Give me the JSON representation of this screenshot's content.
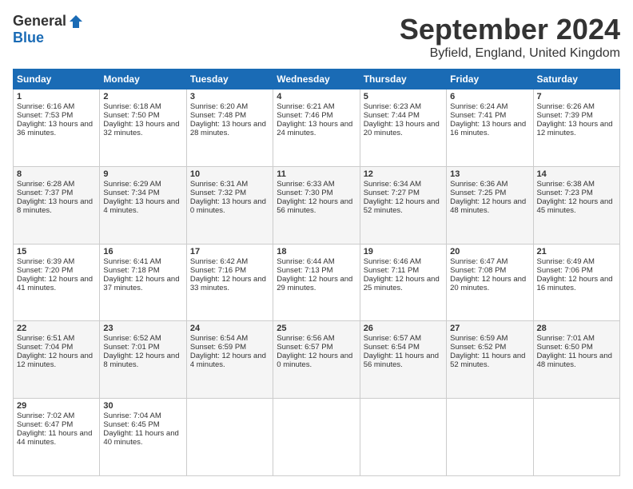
{
  "header": {
    "logo_general": "General",
    "logo_blue": "Blue",
    "title": "September 2024",
    "location": "Byfield, England, United Kingdom"
  },
  "days_header": [
    "Sunday",
    "Monday",
    "Tuesday",
    "Wednesday",
    "Thursday",
    "Friday",
    "Saturday"
  ],
  "weeks": [
    [
      {
        "day": "1",
        "sunrise": "Sunrise: 6:16 AM",
        "sunset": "Sunset: 7:53 PM",
        "daylight": "Daylight: 13 hours and 36 minutes."
      },
      {
        "day": "2",
        "sunrise": "Sunrise: 6:18 AM",
        "sunset": "Sunset: 7:50 PM",
        "daylight": "Daylight: 13 hours and 32 minutes."
      },
      {
        "day": "3",
        "sunrise": "Sunrise: 6:20 AM",
        "sunset": "Sunset: 7:48 PM",
        "daylight": "Daylight: 13 hours and 28 minutes."
      },
      {
        "day": "4",
        "sunrise": "Sunrise: 6:21 AM",
        "sunset": "Sunset: 7:46 PM",
        "daylight": "Daylight: 13 hours and 24 minutes."
      },
      {
        "day": "5",
        "sunrise": "Sunrise: 6:23 AM",
        "sunset": "Sunset: 7:44 PM",
        "daylight": "Daylight: 13 hours and 20 minutes."
      },
      {
        "day": "6",
        "sunrise": "Sunrise: 6:24 AM",
        "sunset": "Sunset: 7:41 PM",
        "daylight": "Daylight: 13 hours and 16 minutes."
      },
      {
        "day": "7",
        "sunrise": "Sunrise: 6:26 AM",
        "sunset": "Sunset: 7:39 PM",
        "daylight": "Daylight: 13 hours and 12 minutes."
      }
    ],
    [
      {
        "day": "8",
        "sunrise": "Sunrise: 6:28 AM",
        "sunset": "Sunset: 7:37 PM",
        "daylight": "Daylight: 13 hours and 8 minutes."
      },
      {
        "day": "9",
        "sunrise": "Sunrise: 6:29 AM",
        "sunset": "Sunset: 7:34 PM",
        "daylight": "Daylight: 13 hours and 4 minutes."
      },
      {
        "day": "10",
        "sunrise": "Sunrise: 6:31 AM",
        "sunset": "Sunset: 7:32 PM",
        "daylight": "Daylight: 13 hours and 0 minutes."
      },
      {
        "day": "11",
        "sunrise": "Sunrise: 6:33 AM",
        "sunset": "Sunset: 7:30 PM",
        "daylight": "Daylight: 12 hours and 56 minutes."
      },
      {
        "day": "12",
        "sunrise": "Sunrise: 6:34 AM",
        "sunset": "Sunset: 7:27 PM",
        "daylight": "Daylight: 12 hours and 52 minutes."
      },
      {
        "day": "13",
        "sunrise": "Sunrise: 6:36 AM",
        "sunset": "Sunset: 7:25 PM",
        "daylight": "Daylight: 12 hours and 48 minutes."
      },
      {
        "day": "14",
        "sunrise": "Sunrise: 6:38 AM",
        "sunset": "Sunset: 7:23 PM",
        "daylight": "Daylight: 12 hours and 45 minutes."
      }
    ],
    [
      {
        "day": "15",
        "sunrise": "Sunrise: 6:39 AM",
        "sunset": "Sunset: 7:20 PM",
        "daylight": "Daylight: 12 hours and 41 minutes."
      },
      {
        "day": "16",
        "sunrise": "Sunrise: 6:41 AM",
        "sunset": "Sunset: 7:18 PM",
        "daylight": "Daylight: 12 hours and 37 minutes."
      },
      {
        "day": "17",
        "sunrise": "Sunrise: 6:42 AM",
        "sunset": "Sunset: 7:16 PM",
        "daylight": "Daylight: 12 hours and 33 minutes."
      },
      {
        "day": "18",
        "sunrise": "Sunrise: 6:44 AM",
        "sunset": "Sunset: 7:13 PM",
        "daylight": "Daylight: 12 hours and 29 minutes."
      },
      {
        "day": "19",
        "sunrise": "Sunrise: 6:46 AM",
        "sunset": "Sunset: 7:11 PM",
        "daylight": "Daylight: 12 hours and 25 minutes."
      },
      {
        "day": "20",
        "sunrise": "Sunrise: 6:47 AM",
        "sunset": "Sunset: 7:08 PM",
        "daylight": "Daylight: 12 hours and 20 minutes."
      },
      {
        "day": "21",
        "sunrise": "Sunrise: 6:49 AM",
        "sunset": "Sunset: 7:06 PM",
        "daylight": "Daylight: 12 hours and 16 minutes."
      }
    ],
    [
      {
        "day": "22",
        "sunrise": "Sunrise: 6:51 AM",
        "sunset": "Sunset: 7:04 PM",
        "daylight": "Daylight: 12 hours and 12 minutes."
      },
      {
        "day": "23",
        "sunrise": "Sunrise: 6:52 AM",
        "sunset": "Sunset: 7:01 PM",
        "daylight": "Daylight: 12 hours and 8 minutes."
      },
      {
        "day": "24",
        "sunrise": "Sunrise: 6:54 AM",
        "sunset": "Sunset: 6:59 PM",
        "daylight": "Daylight: 12 hours and 4 minutes."
      },
      {
        "day": "25",
        "sunrise": "Sunrise: 6:56 AM",
        "sunset": "Sunset: 6:57 PM",
        "daylight": "Daylight: 12 hours and 0 minutes."
      },
      {
        "day": "26",
        "sunrise": "Sunrise: 6:57 AM",
        "sunset": "Sunset: 6:54 PM",
        "daylight": "Daylight: 11 hours and 56 minutes."
      },
      {
        "day": "27",
        "sunrise": "Sunrise: 6:59 AM",
        "sunset": "Sunset: 6:52 PM",
        "daylight": "Daylight: 11 hours and 52 minutes."
      },
      {
        "day": "28",
        "sunrise": "Sunrise: 7:01 AM",
        "sunset": "Sunset: 6:50 PM",
        "daylight": "Daylight: 11 hours and 48 minutes."
      }
    ],
    [
      {
        "day": "29",
        "sunrise": "Sunrise: 7:02 AM",
        "sunset": "Sunset: 6:47 PM",
        "daylight": "Daylight: 11 hours and 44 minutes."
      },
      {
        "day": "30",
        "sunrise": "Sunrise: 7:04 AM",
        "sunset": "Sunset: 6:45 PM",
        "daylight": "Daylight: 11 hours and 40 minutes."
      },
      null,
      null,
      null,
      null,
      null
    ]
  ]
}
